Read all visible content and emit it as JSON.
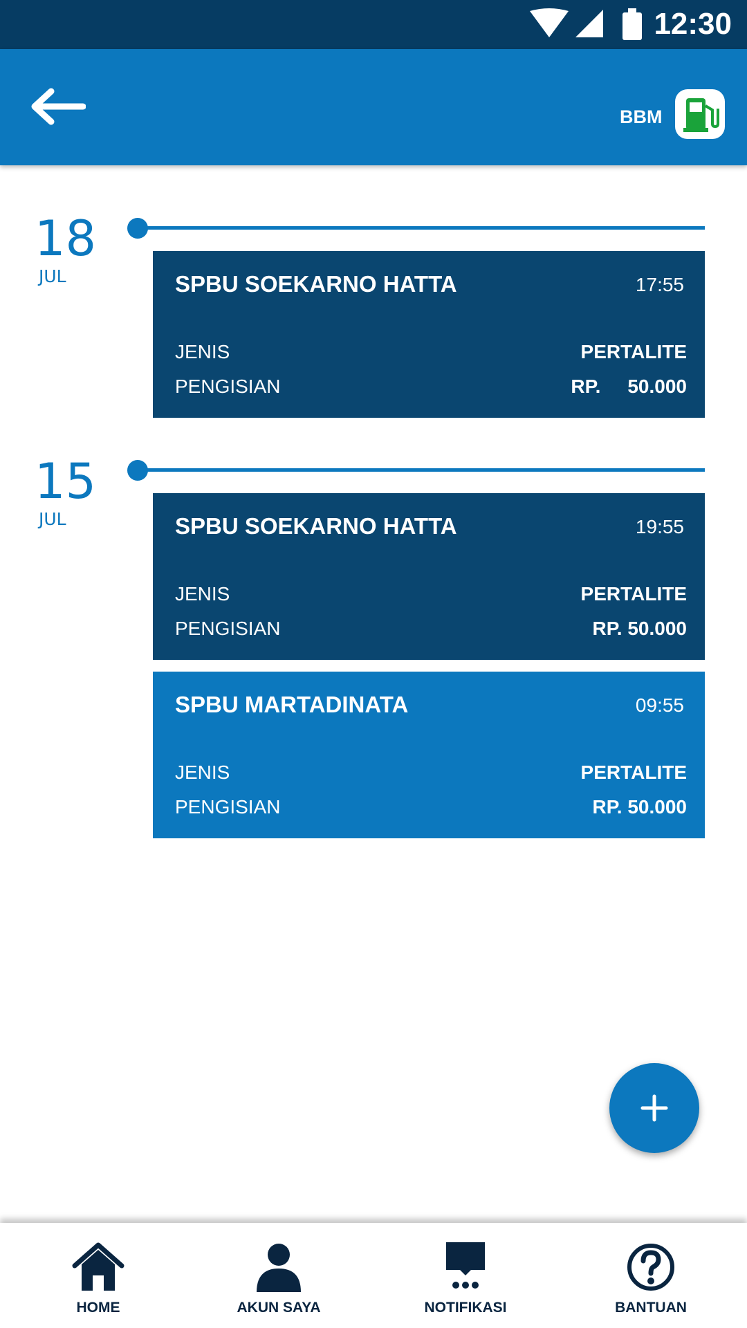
{
  "status_bar": {
    "time": "12:30"
  },
  "header": {
    "category_label": "BBM"
  },
  "timeline": [
    {
      "day": "18",
      "month": "JUL",
      "entries": [
        {
          "station": "SPBU SOEKARNO HATTA",
          "time": "17:55",
          "type_label": "JENIS",
          "fill_label": "PENGISIAN",
          "fuel": "PERTALITE",
          "amount": "RP.     50.000"
        }
      ]
    },
    {
      "day": "15",
      "month": "JUL",
      "entries": [
        {
          "station": "SPBU SOEKARNO HATTA",
          "time": "19:55",
          "type_label": "JENIS",
          "fill_label": "PENGISIAN",
          "fuel": "PERTALITE",
          "amount": "RP. 50.000"
        },
        {
          "station": "SPBU MARTADINATA",
          "time": "09:55",
          "type_label": "JENIS",
          "fill_label": "PENGISIAN",
          "fuel": "PERTALITE",
          "amount": "RP. 50.000"
        }
      ]
    }
  ],
  "bottom_nav": [
    {
      "label": "HOME",
      "icon": "home-icon"
    },
    {
      "label": "AKUN SAYA",
      "icon": "user-icon"
    },
    {
      "label": "NOTIFIKASI",
      "icon": "notification-icon"
    },
    {
      "label": "BANTUAN",
      "icon": "help-icon"
    }
  ],
  "colors": {
    "primary": "#0c78be",
    "card_dark": "#0a4670",
    "status_bar": "#063c63",
    "fuel_icon": "#1aa33a"
  }
}
